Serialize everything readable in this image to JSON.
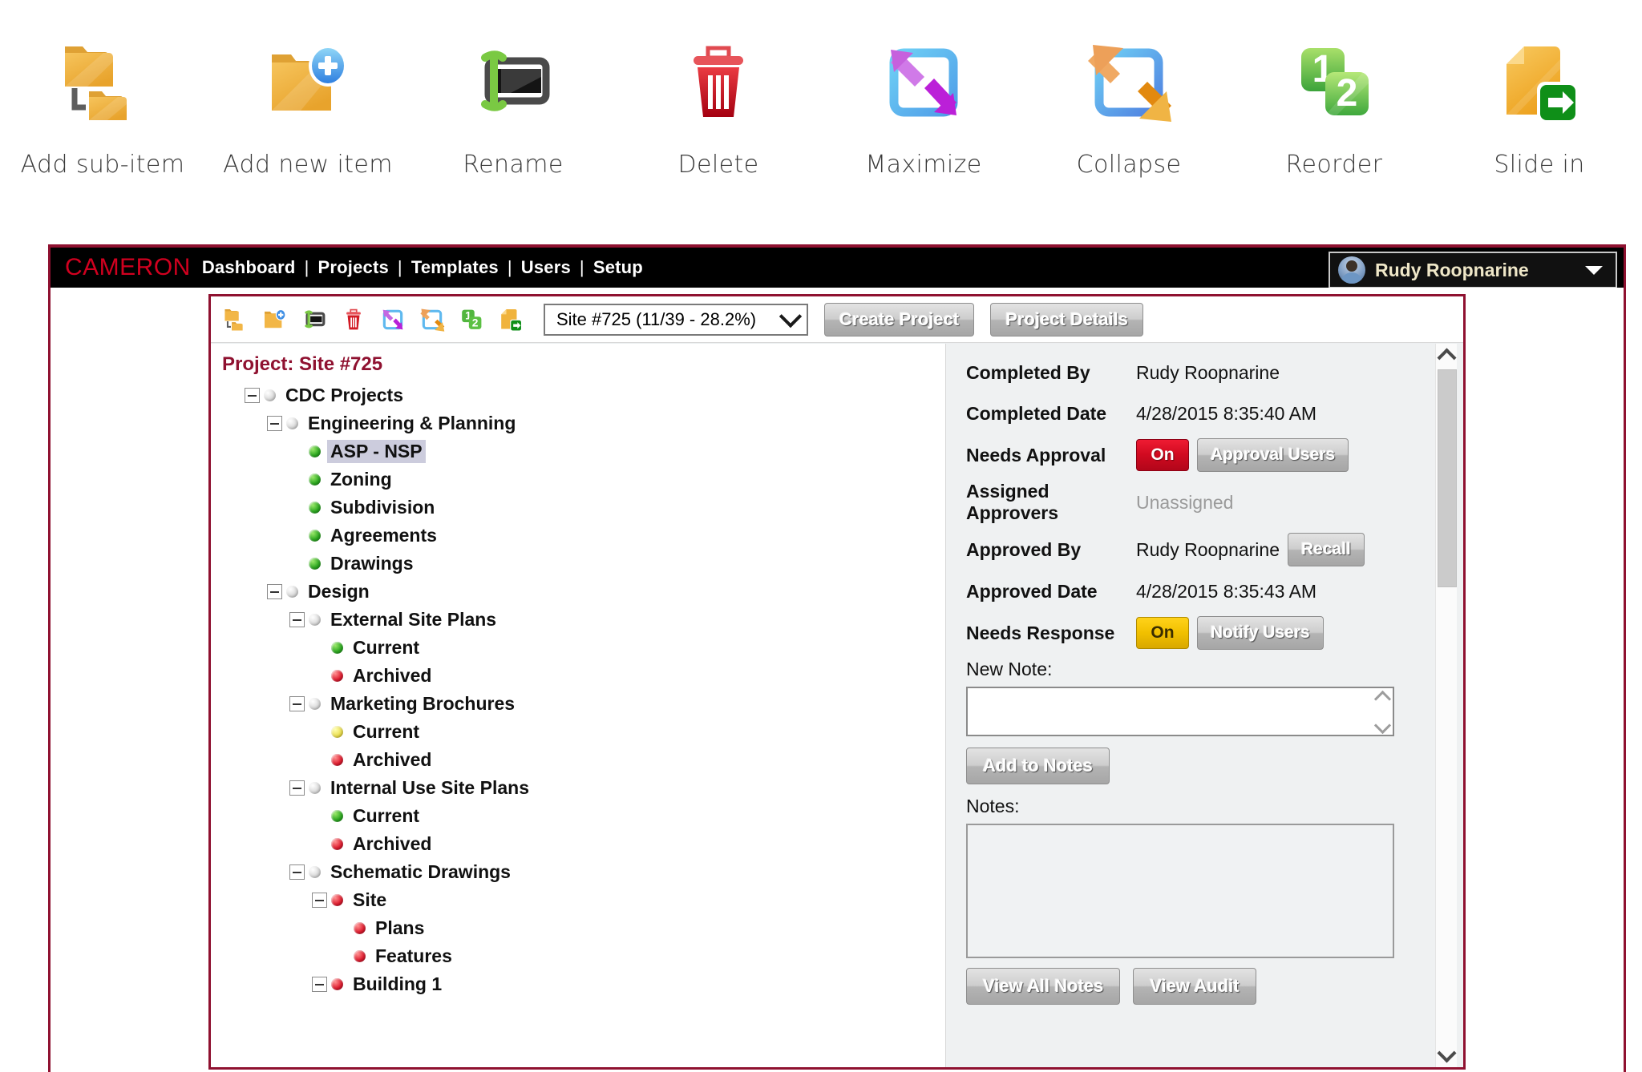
{
  "legend": {
    "items": [
      {
        "label": "Add sub-item",
        "icon": "folder-sub-item-icon"
      },
      {
        "label": "Add new item",
        "icon": "folder-add-icon"
      },
      {
        "label": "Rename",
        "icon": "rename-icon"
      },
      {
        "label": "Delete",
        "icon": "trash-icon"
      },
      {
        "label": "Maximize",
        "icon": "maximize-arrows-icon"
      },
      {
        "label": "Collapse",
        "icon": "collapse-arrows-icon"
      },
      {
        "label": "Reorder",
        "icon": "reorder-numbers-icon"
      },
      {
        "label": "Slide in",
        "icon": "slide-in-icon"
      }
    ]
  },
  "topbar": {
    "brand": "CAMERON",
    "nav": [
      "Dashboard",
      "Projects",
      "Templates",
      "Users",
      "Setup"
    ],
    "separator": "|",
    "user": "Rudy Roopnarine"
  },
  "toolbar": {
    "icons": [
      "folder-sub-item-icon",
      "folder-add-icon",
      "rename-icon",
      "trash-icon",
      "maximize-arrows-icon",
      "collapse-arrows-icon",
      "reorder-numbers-icon",
      "slide-in-icon"
    ],
    "project_select_value": "Site #725 (11/39 - 28.2%)",
    "create_project_label": "Create Project",
    "project_details_label": "Project Details"
  },
  "tree": {
    "title": "Project: Site #725",
    "nodes": [
      {
        "label": "CDC Projects",
        "depth": 1,
        "expander": true,
        "bullet": "grey",
        "selected": false
      },
      {
        "label": "Engineering & Planning",
        "depth": 2,
        "expander": true,
        "bullet": "grey",
        "selected": false
      },
      {
        "label": "ASP - NSP",
        "depth": 3,
        "expander": false,
        "bullet": "green",
        "selected": true
      },
      {
        "label": "Zoning",
        "depth": 3,
        "expander": false,
        "bullet": "green",
        "selected": false
      },
      {
        "label": "Subdivision",
        "depth": 3,
        "expander": false,
        "bullet": "green",
        "selected": false
      },
      {
        "label": "Agreements",
        "depth": 3,
        "expander": false,
        "bullet": "green",
        "selected": false
      },
      {
        "label": "Drawings",
        "depth": 3,
        "expander": false,
        "bullet": "green",
        "selected": false
      },
      {
        "label": "Design",
        "depth": 2,
        "expander": true,
        "bullet": "grey",
        "selected": false
      },
      {
        "label": "External Site Plans",
        "depth": 3,
        "expander": true,
        "bullet": "grey",
        "selected": false
      },
      {
        "label": "Current",
        "depth": 4,
        "expander": false,
        "bullet": "green",
        "selected": false
      },
      {
        "label": "Archived",
        "depth": 4,
        "expander": false,
        "bullet": "red",
        "selected": false
      },
      {
        "label": "Marketing Brochures",
        "depth": 3,
        "expander": true,
        "bullet": "grey",
        "selected": false
      },
      {
        "label": "Current",
        "depth": 4,
        "expander": false,
        "bullet": "yellow",
        "selected": false
      },
      {
        "label": "Archived",
        "depth": 4,
        "expander": false,
        "bullet": "red",
        "selected": false
      },
      {
        "label": "Internal Use Site Plans",
        "depth": 3,
        "expander": true,
        "bullet": "grey",
        "selected": false
      },
      {
        "label": "Current",
        "depth": 4,
        "expander": false,
        "bullet": "green",
        "selected": false
      },
      {
        "label": "Archived",
        "depth": 4,
        "expander": false,
        "bullet": "red",
        "selected": false
      },
      {
        "label": "Schematic Drawings",
        "depth": 3,
        "expander": true,
        "bullet": "grey",
        "selected": false
      },
      {
        "label": "Site",
        "depth": 4,
        "expander": true,
        "bullet": "red",
        "selected": false
      },
      {
        "label": "Plans",
        "depth": 5,
        "expander": false,
        "bullet": "red",
        "selected": false
      },
      {
        "label": "Features",
        "depth": 5,
        "expander": false,
        "bullet": "red",
        "selected": false
      },
      {
        "label": "Building 1",
        "depth": 4,
        "expander": true,
        "bullet": "red",
        "selected": false
      }
    ]
  },
  "details": {
    "completed_by_label": "Completed By",
    "completed_by_value": "Rudy Roopnarine",
    "completed_date_label": "Completed Date",
    "completed_date_value": "4/28/2015 8:35:40 AM",
    "needs_approval_label": "Needs Approval",
    "needs_approval_state": "On",
    "approval_users_label": "Approval Users",
    "assigned_approvers_label": "Assigned Approvers",
    "assigned_approvers_value": "Unassigned",
    "approved_by_label": "Approved By",
    "approved_by_value": "Rudy Roopnarine",
    "recall_label": "Recall",
    "approved_date_label": "Approved Date",
    "approved_date_value": "4/28/2015 8:35:43 AM",
    "needs_response_label": "Needs Response",
    "needs_response_state": "On",
    "notify_users_label": "Notify Users",
    "new_note_label": "New Note:",
    "new_note_value": "",
    "add_to_notes_label": "Add to Notes",
    "notes_label": "Notes:",
    "notes_value": "",
    "view_all_notes_label": "View All Notes",
    "view_audit_label": "View Audit"
  },
  "colors": {
    "brand_red": "#d1001f",
    "panel_border": "#8f1130",
    "on_red": "#d00a20",
    "on_yellow": "#f1c000",
    "topbar_bg": "#000000"
  }
}
